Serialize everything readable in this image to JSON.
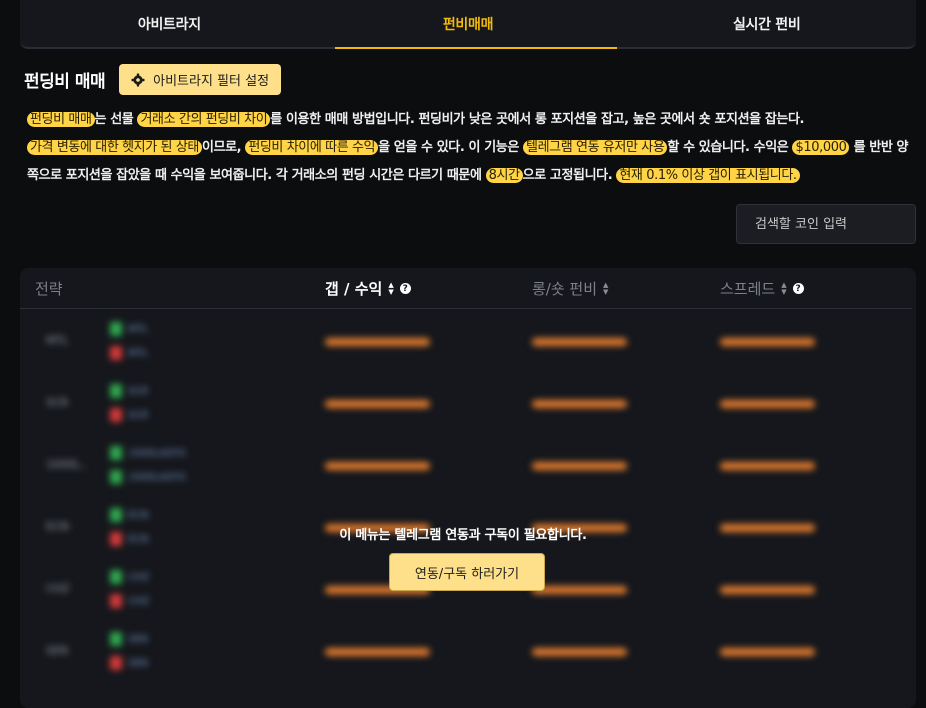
{
  "tabs": [
    {
      "label": "아비트라지",
      "active": false
    },
    {
      "label": "펀비매매",
      "active": true
    },
    {
      "label": "실시간 펀비",
      "active": false
    }
  ],
  "header": {
    "title": "펀딩비 매매",
    "filter_button": "아비트라지 필터 설정"
  },
  "description": {
    "p1_hl1": "펀딩비 매매",
    "p1_t1": "는 선물 ",
    "p1_hl2": "거래소 간의 펀딩비 차이",
    "p1_t2": "를 이용한 매매 방법입니다. 펀딩비가 낮은 곳에서 롱 포지션을 잡고, 높은 곳에서 숏 포지션을 잡는다.",
    "p2_hl1": "가격 변동에 대한 헷지가 된 상태",
    "p2_t1": "이므로, ",
    "p2_hl2": "펀딩비 차이에 따른 수익",
    "p2_t2": "을 얻을 수 있다. 이 기능은 ",
    "p2_hl3": "텔레그램 연동 유저만 사용",
    "p2_t3": "할 수 있습니다. 수익은 ",
    "p2_hl4": "$10,000",
    "p2_t4": " 를 반반 양쪽으로 포지션을 잡았을 때 수익을 보여줍니다. 각 거래소의 펀딩 시간은 다르기 때문에 ",
    "p2_hl5": "8시간",
    "p2_t5": "으로 고정됩니다. ",
    "p2_hl6": "현재 0.1% 이상 갭이 표시됩니다."
  },
  "search": {
    "placeholder": "검색할 코인 입력"
  },
  "table": {
    "headers": {
      "strategy": "전략",
      "gap": "갭 / 수익",
      "long_short": "롱/숏 펀비",
      "spread": "스프레드"
    },
    "rows": [
      {
        "coin": "MTL",
        "long": "MTL",
        "short": "MTL"
      },
      {
        "coin": "SCR",
        "long": "SCR",
        "short": "SCR"
      },
      {
        "coin": "1000L..",
        "long": "1000LADYS",
        "short": "1000LADYS"
      },
      {
        "coin": "ECN",
        "long": "ECN",
        "short": "ECN"
      },
      {
        "coin": "CHZ",
        "long": "CHZ",
        "short": "CHZ"
      },
      {
        "coin": "SEN",
        "long": "SEN",
        "short": "SEN"
      }
    ]
  },
  "lock": {
    "message": "이 메뉴는 텔레그램 연동과 구독이 필요합니다.",
    "button": "연동/구독 하러가기"
  },
  "colors": {
    "accent": "#f0b90b",
    "highlight": "#ffd447",
    "button": "#ffe08a",
    "bar": "#e07a2e"
  }
}
